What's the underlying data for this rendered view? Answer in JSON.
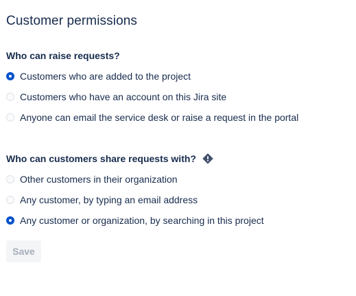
{
  "page": {
    "title": "Customer permissions"
  },
  "raise_requests": {
    "heading": "Who can raise requests?",
    "options": [
      {
        "label": "Customers who are added to the project",
        "selected": true
      },
      {
        "label": "Customers who have an account on this Jira site",
        "selected": false
      },
      {
        "label": "Anyone can email the service desk or raise a request in the portal",
        "selected": false
      }
    ]
  },
  "share_requests": {
    "heading": "Who can customers share requests with?",
    "heading_icon": "warning-diamond-icon",
    "options": [
      {
        "label": "Other customers in their organization",
        "selected": false
      },
      {
        "label": "Any customer, by typing an email address",
        "selected": false
      },
      {
        "label": "Any customer or organization, by searching in this project",
        "selected": true
      }
    ]
  },
  "actions": {
    "save_label": "Save",
    "save_disabled": true
  },
  "colors": {
    "text": "#172b4d",
    "selected": "#0052cc",
    "disabled_text": "#a5adba",
    "disabled_bg": "#f4f5f7"
  }
}
